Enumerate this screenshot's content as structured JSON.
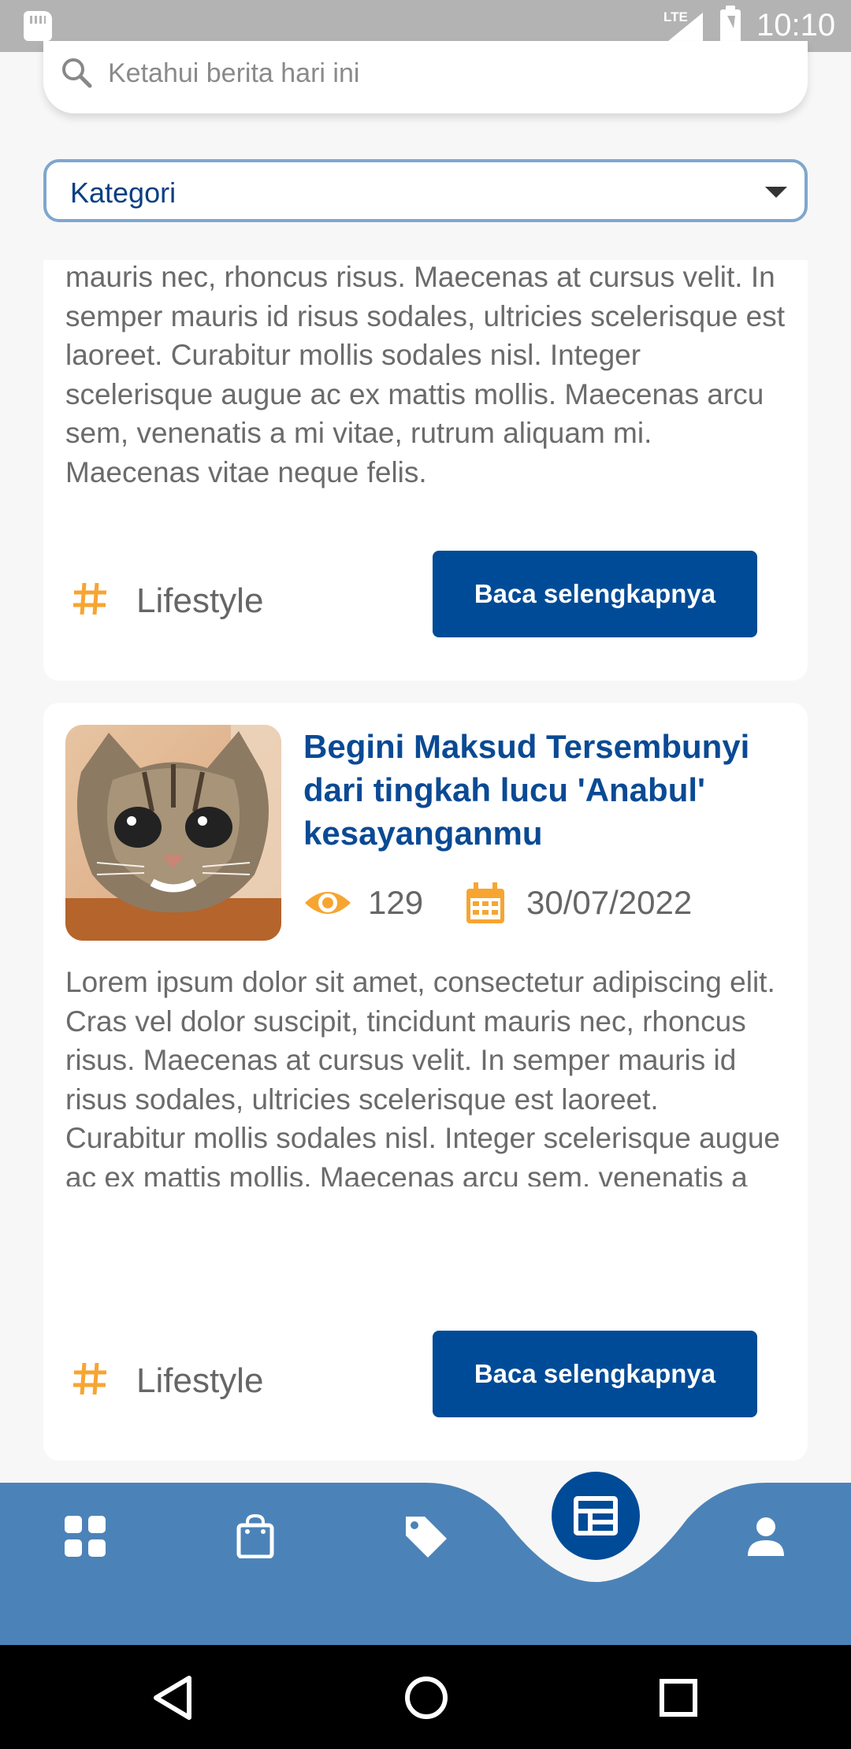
{
  "status_bar": {
    "network": "LTE",
    "time": "10:10"
  },
  "search": {
    "placeholder": "Ketahui berita hari ini"
  },
  "category_select": {
    "label": "Kategori"
  },
  "articles": [
    {
      "excerpt": "Lorem ipsum dolor sit amet, consectetur adipiscing elit. Cras vel dolor suscipit, tincidunt mauris nec, rhoncus risus. Maecenas at cursus velit. In semper mauris id risus sodales, ultricies scelerisque est laoreet. Curabitur mollis sodales nisl. Integer scelerisque augue ac ex mattis mollis. Maecenas arcu sem, venenatis a mi vitae, rutrum aliquam mi. Maecenas vitae neque felis.",
      "excerpt_visible_from": "mauris nec, rhoncus risus. Maecenas at cursus velit. In semper mauris id risus sodales, ultricies scelerisque est laoreet. Curabitur mollis sodales nisl. Integer scelerisque augue ac ex mattis mollis. Maecenas arcu sem, venenatis a mi vitae, rutrum aliquam mi. Maecenas vitae neque felis.",
      "tag": "Lifestyle",
      "read_more_label": "Baca selengkapnya"
    },
    {
      "title": "Begini Maksud Tersembunyi dari tingkah lucu 'Anabul' kesayanganmu",
      "views": "129",
      "date": "30/07/2022",
      "excerpt": "Lorem ipsum dolor sit amet, consectetur adipiscing elit. Cras vel dolor suscipit, tincidunt mauris nec, rhoncus risus. Maecenas at cursus velit. In semper mauris id risus sodales, ultricies scelerisque est laoreet. Curabitur mollis sodales nisl. Integer scelerisque augue ac ex mattis mollis. Maecenas arcu sem, venenatis a mi vitae, rutrum aliquam mi. Maecenas vitae neque felis.",
      "tag": "Lifestyle",
      "read_more_label": "Baca selengkapnya",
      "thumbnail": "cat-photo"
    }
  ],
  "bottom_nav": {
    "items": [
      "dashboard-icon",
      "shopping-bag-icon",
      "tag-icon",
      "news-icon",
      "person-icon"
    ],
    "active": "news-icon"
  },
  "colors": {
    "primary": "#004b97",
    "title": "#0a4a94",
    "accent": "#f7a531",
    "nav_bg": "#4b83b8"
  }
}
